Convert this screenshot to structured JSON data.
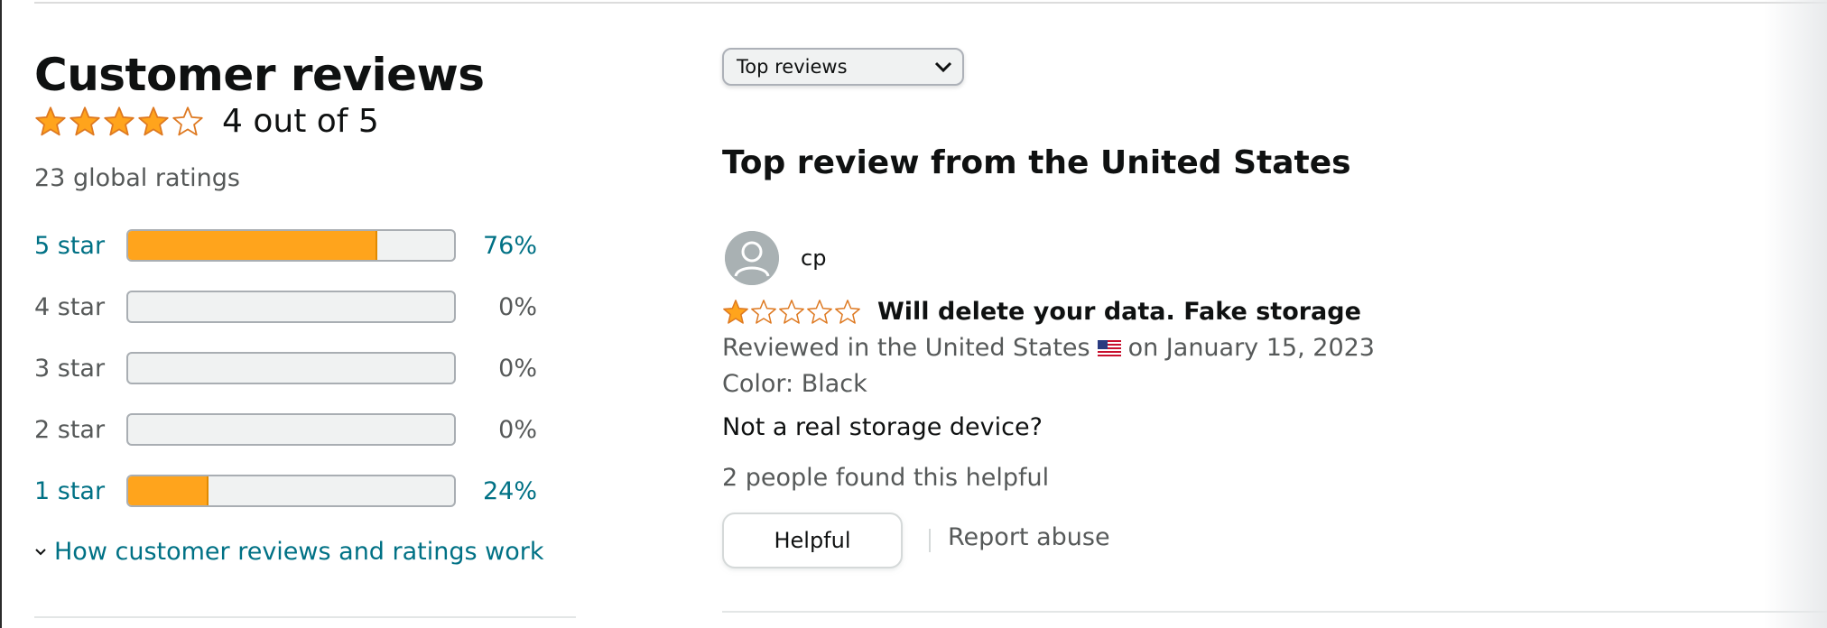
{
  "reviews_summary": {
    "title": "Customer reviews",
    "average_rating": 4,
    "rating_text": "4 out of 5",
    "global_ratings_text": "23 global ratings",
    "histogram": [
      {
        "label": "5 star",
        "percent_text": "76%",
        "fraction": 0.76,
        "linked": true
      },
      {
        "label": "4 star",
        "percent_text": "0%",
        "fraction": 0,
        "linked": false
      },
      {
        "label": "3 star",
        "percent_text": "0%",
        "fraction": 0,
        "linked": false
      },
      {
        "label": "2 star",
        "percent_text": "0%",
        "fraction": 0,
        "linked": false
      },
      {
        "label": "1 star",
        "percent_text": "24%",
        "fraction": 0.24,
        "linked": true
      }
    ],
    "how_link": "How customer reviews and ratings work"
  },
  "sort": {
    "selected": "Top reviews"
  },
  "section": {
    "title": "Top review from the United States"
  },
  "review": {
    "reviewer": "cp",
    "rating": 1,
    "title": "Will delete your data. Fake storage",
    "meta_prefix": "Reviewed in the United States",
    "meta_suffix": "on January 15, 2023",
    "variant": "Color: Black",
    "body": "Not a real storage device?",
    "helpful_count": "2 people found this helpful",
    "helpful_button": "Helpful",
    "report_link": "Report abuse"
  },
  "colors": {
    "star": "#ffa41c",
    "link": "#007185",
    "muted_text": "#565959"
  },
  "icons": {
    "star_full": "star-icon",
    "star_empty": "star-outline-icon",
    "avatar": "avatar-placeholder-icon",
    "flag": "us-flag-icon",
    "chevron": "chevron-down-icon"
  }
}
